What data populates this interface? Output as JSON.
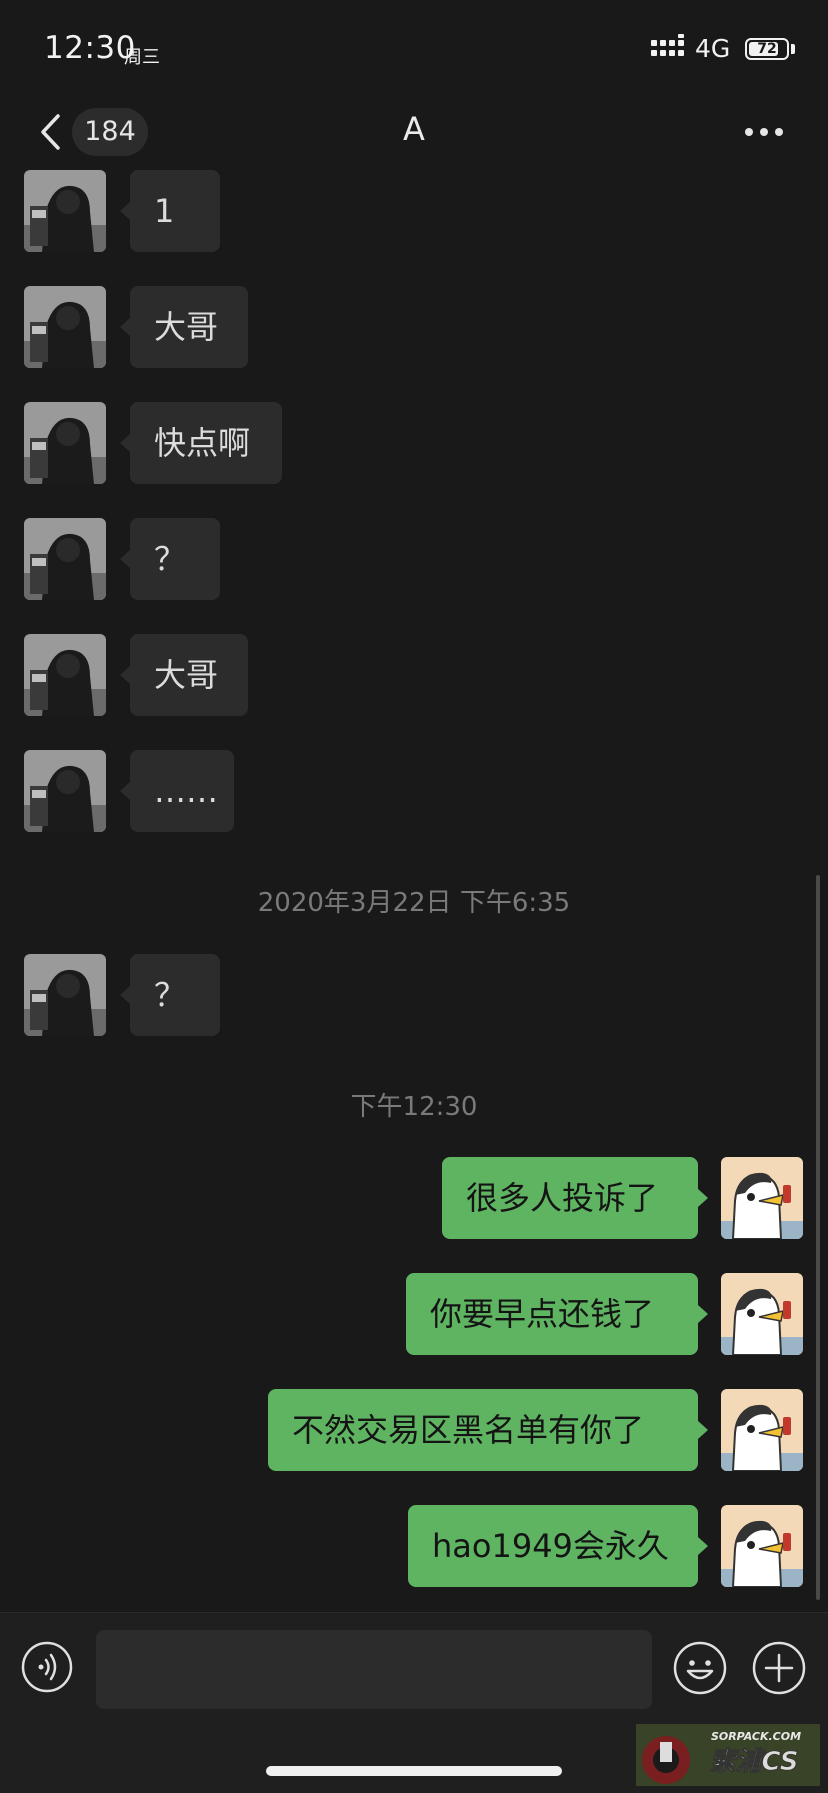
{
  "status_bar": {
    "time": "12:30",
    "day": "周三",
    "network": "4G",
    "battery": "72"
  },
  "nav": {
    "unread_badge": "184",
    "title": "A"
  },
  "messages_in_top": [
    {
      "text": "1"
    },
    {
      "text": "大哥"
    },
    {
      "text": "快点啊"
    },
    {
      "text": "？"
    },
    {
      "text": "大哥"
    },
    {
      "text": "……"
    }
  ],
  "timestamp_1": "2020年3月22日 下午6:35",
  "message_in_after_ts": {
    "text": "？"
  },
  "timestamp_2": "下午12:30",
  "messages_out": [
    {
      "text": "很多人投诉了"
    },
    {
      "text": "你要早点还钱了"
    },
    {
      "text": "不然交易区黑名单有你了"
    },
    {
      "text": "hao1949会永久"
    }
  ],
  "input": {
    "value": "",
    "placeholder": ""
  },
  "watermark": {
    "line1": "SORPACK.COM",
    "line2": "索浦CS"
  },
  "colors": {
    "background": "#191919",
    "incoming_bubble": "#2c2c2c",
    "outgoing_bubble": "#5fb462"
  }
}
